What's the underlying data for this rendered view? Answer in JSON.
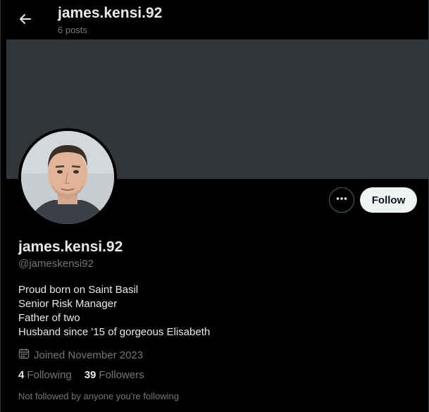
{
  "header": {
    "title": "james.kensi.92",
    "posts_count": "6 posts"
  },
  "profile": {
    "display_name": "james.kensi.92",
    "handle": "@jameskensi92",
    "bio": [
      "Proud born on Saint Basil",
      "Senior Risk Manager",
      "Father of two",
      "Husband since '15 of gorgeous Elisabeth"
    ],
    "joined": "Joined November 2023",
    "following_count": "4",
    "following_label": "Following",
    "followers_count": "39",
    "followers_label": "Followers",
    "not_followed_note": "Not followed by anyone you're following"
  },
  "actions": {
    "follow_label": "Follow",
    "more_icon": "more-horizontal-icon"
  },
  "icons": {
    "back": "arrow-left-icon",
    "calendar": "calendar-icon"
  },
  "colors": {
    "background": "#000000",
    "banner": "#333639",
    "primary_text": "#e7e9ea",
    "secondary_text": "#71767b",
    "follow_button_bg": "#eff3f4"
  }
}
